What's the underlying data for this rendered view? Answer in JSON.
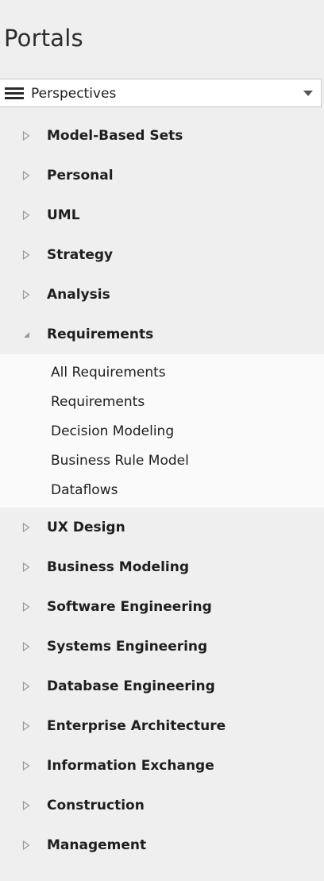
{
  "panel": {
    "title": "Portals"
  },
  "dropdown": {
    "icon": "hamburger-menu-icon",
    "selected": "Perspectives",
    "caret": "chevron-down-icon"
  },
  "tree": {
    "items": [
      {
        "label": "Model-Based Sets",
        "expanded": false
      },
      {
        "label": "Personal",
        "expanded": false
      },
      {
        "label": "UML",
        "expanded": false
      },
      {
        "label": "Strategy",
        "expanded": false
      },
      {
        "label": "Analysis",
        "expanded": false
      },
      {
        "label": "Requirements",
        "expanded": true,
        "children": [
          "All Requirements",
          "Requirements",
          "Decision Modeling",
          "Business Rule Model",
          "Dataflows"
        ]
      },
      {
        "label": "UX Design",
        "expanded": false
      },
      {
        "label": "Business Modeling",
        "expanded": false
      },
      {
        "label": "Software Engineering",
        "expanded": false
      },
      {
        "label": "Systems Engineering",
        "expanded": false
      },
      {
        "label": "Database Engineering",
        "expanded": false
      },
      {
        "label": "Enterprise Architecture",
        "expanded": false
      },
      {
        "label": "Information Exchange",
        "expanded": false
      },
      {
        "label": "Construction",
        "expanded": false
      },
      {
        "label": "Management",
        "expanded": false
      }
    ]
  },
  "colors": {
    "panel_bg": "#efefef",
    "expanded_bg": "#fafafa",
    "arrow": "#9a9a9a",
    "text": "#1e1e1e"
  }
}
